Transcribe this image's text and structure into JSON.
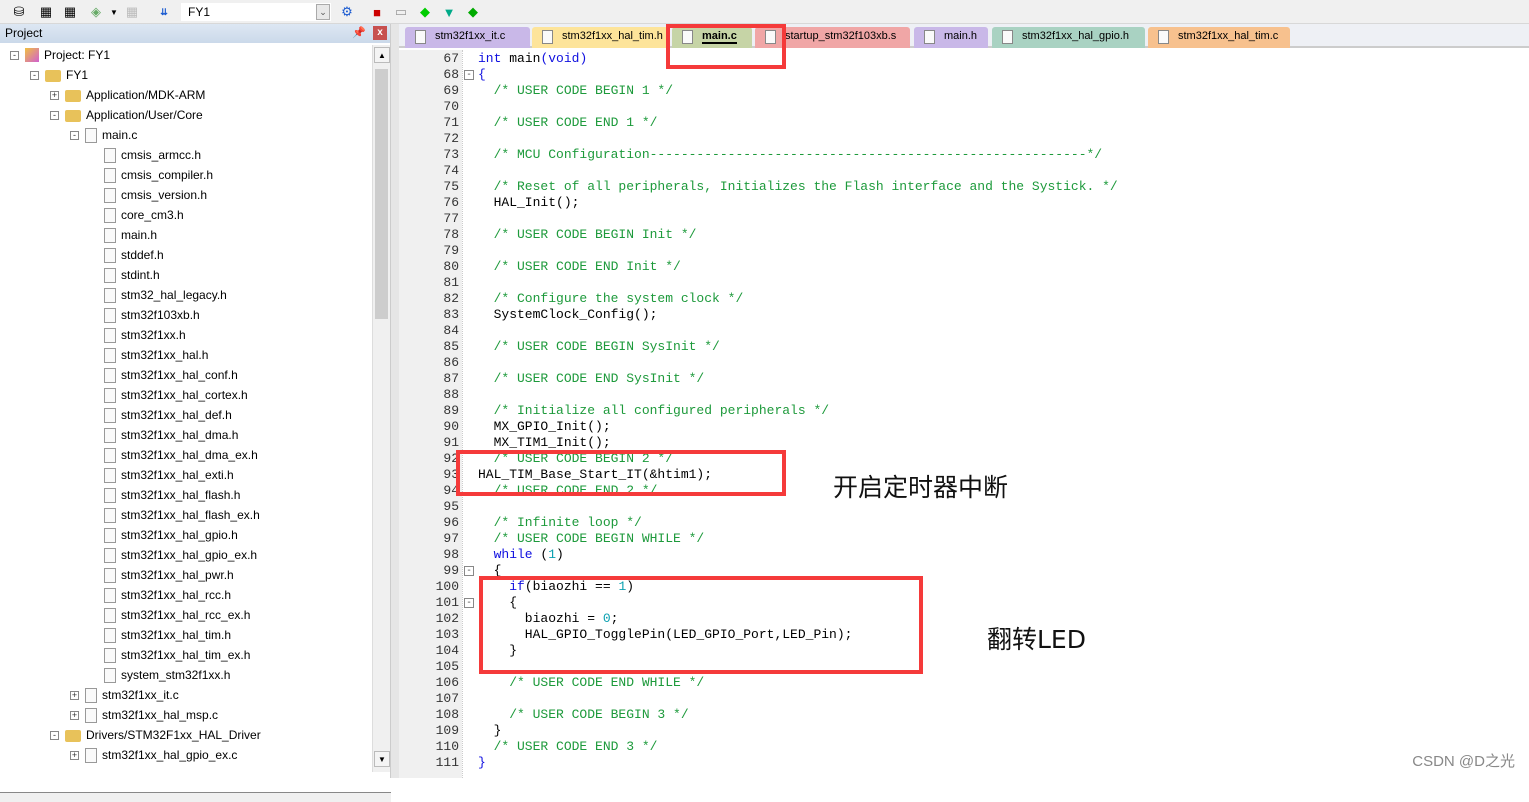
{
  "toolbar": {
    "target": "FY1",
    "icons": [
      "batch-build-icon",
      "build-icon",
      "rebuild-icon",
      "batch-icon",
      "stop-build-icon",
      "download-load-icon",
      "options-wand-icon",
      "manage-components-icon",
      "windows-icon",
      "green-diamond-icon",
      "pack-installer-icon",
      "select-packs-icon"
    ]
  },
  "project_panel": {
    "title": "Project",
    "tree": [
      {
        "label": "Project: FY1",
        "level": 0,
        "exp": "-",
        "icon": "project"
      },
      {
        "label": "FY1",
        "level": 1,
        "exp": "-",
        "icon": "folder"
      },
      {
        "label": "Application/MDK-ARM",
        "level": 2,
        "exp": "+",
        "icon": "folder"
      },
      {
        "label": "Application/User/Core",
        "level": 2,
        "exp": "-",
        "icon": "folder"
      },
      {
        "label": "main.c",
        "level": 3,
        "exp": "-",
        "icon": "file"
      },
      {
        "label": "cmsis_armcc.h",
        "level": 4,
        "icon": "file"
      },
      {
        "label": "cmsis_compiler.h",
        "level": 4,
        "icon": "file"
      },
      {
        "label": "cmsis_version.h",
        "level": 4,
        "icon": "file"
      },
      {
        "label": "core_cm3.h",
        "level": 4,
        "icon": "file"
      },
      {
        "label": "main.h",
        "level": 4,
        "icon": "file"
      },
      {
        "label": "stddef.h",
        "level": 4,
        "icon": "file"
      },
      {
        "label": "stdint.h",
        "level": 4,
        "icon": "file"
      },
      {
        "label": "stm32_hal_legacy.h",
        "level": 4,
        "icon": "file"
      },
      {
        "label": "stm32f103xb.h",
        "level": 4,
        "icon": "file"
      },
      {
        "label": "stm32f1xx.h",
        "level": 4,
        "icon": "file"
      },
      {
        "label": "stm32f1xx_hal.h",
        "level": 4,
        "icon": "file"
      },
      {
        "label": "stm32f1xx_hal_conf.h",
        "level": 4,
        "icon": "file"
      },
      {
        "label": "stm32f1xx_hal_cortex.h",
        "level": 4,
        "icon": "file"
      },
      {
        "label": "stm32f1xx_hal_def.h",
        "level": 4,
        "icon": "file"
      },
      {
        "label": "stm32f1xx_hal_dma.h",
        "level": 4,
        "icon": "file"
      },
      {
        "label": "stm32f1xx_hal_dma_ex.h",
        "level": 4,
        "icon": "file"
      },
      {
        "label": "stm32f1xx_hal_exti.h",
        "level": 4,
        "icon": "file"
      },
      {
        "label": "stm32f1xx_hal_flash.h",
        "level": 4,
        "icon": "file"
      },
      {
        "label": "stm32f1xx_hal_flash_ex.h",
        "level": 4,
        "icon": "file"
      },
      {
        "label": "stm32f1xx_hal_gpio.h",
        "level": 4,
        "icon": "file"
      },
      {
        "label": "stm32f1xx_hal_gpio_ex.h",
        "level": 4,
        "icon": "file"
      },
      {
        "label": "stm32f1xx_hal_pwr.h",
        "level": 4,
        "icon": "file"
      },
      {
        "label": "stm32f1xx_hal_rcc.h",
        "level": 4,
        "icon": "file"
      },
      {
        "label": "stm32f1xx_hal_rcc_ex.h",
        "level": 4,
        "icon": "file"
      },
      {
        "label": "stm32f1xx_hal_tim.h",
        "level": 4,
        "icon": "file"
      },
      {
        "label": "stm32f1xx_hal_tim_ex.h",
        "level": 4,
        "icon": "file"
      },
      {
        "label": "system_stm32f1xx.h",
        "level": 4,
        "icon": "file"
      },
      {
        "label": "stm32f1xx_it.c",
        "level": 3,
        "exp": "+",
        "icon": "file"
      },
      {
        "label": "stm32f1xx_hal_msp.c",
        "level": 3,
        "exp": "+",
        "icon": "file"
      },
      {
        "label": "Drivers/STM32F1xx_HAL_Driver",
        "level": 2,
        "exp": "-",
        "icon": "folder"
      },
      {
        "label": "stm32f1xx_hal_gpio_ex.c",
        "level": 3,
        "exp": "+",
        "icon": "file"
      }
    ]
  },
  "tabs": [
    {
      "label": "stm32f1xx_it.c",
      "color": "#c9b8e8"
    },
    {
      "label": "stm32f1xx_hal_tim.h",
      "color": "#fde49a"
    },
    {
      "label": "main.c",
      "color": "#c6d4a6",
      "active": true
    },
    {
      "label": "startup_stm32f103xb.s",
      "color": "#f0a6a6"
    },
    {
      "label": "main.h",
      "color": "#c9b8e8"
    },
    {
      "label": "stm32f1xx_hal_gpio.h",
      "color": "#a9d2c2"
    },
    {
      "label": "stm32f1xx_hal_tim.c",
      "color": "#f7c18e"
    }
  ],
  "code": [
    {
      "n": 67,
      "s": [
        [
          "int ",
          "kw"
        ],
        [
          "main",
          "pl"
        ],
        [
          "(",
          "pn"
        ],
        [
          "void",
          "kw"
        ],
        [
          ")",
          "pn"
        ]
      ]
    },
    {
      "n": 68,
      "f": "-",
      "s": [
        [
          "{",
          "pn"
        ]
      ]
    },
    {
      "n": 69,
      "s": [
        [
          "  /* USER CODE BEGIN 1 */",
          "cm"
        ]
      ]
    },
    {
      "n": 70,
      "s": []
    },
    {
      "n": 71,
      "s": [
        [
          "  /* USER CODE END 1 */",
          "cm"
        ]
      ]
    },
    {
      "n": 72,
      "s": []
    },
    {
      "n": 73,
      "s": [
        [
          "  /* MCU Configuration--------------------------------------------------------*/",
          "cm"
        ]
      ]
    },
    {
      "n": 74,
      "s": []
    },
    {
      "n": 75,
      "s": [
        [
          "  /* Reset of all peripherals, Initializes the Flash interface and the Systick. */",
          "cm"
        ]
      ]
    },
    {
      "n": 76,
      "s": [
        [
          "  HAL_Init();",
          "pl"
        ]
      ]
    },
    {
      "n": 77,
      "s": []
    },
    {
      "n": 78,
      "s": [
        [
          "  /* USER CODE BEGIN Init */",
          "cm"
        ]
      ]
    },
    {
      "n": 79,
      "s": []
    },
    {
      "n": 80,
      "s": [
        [
          "  /* USER CODE END Init */",
          "cm"
        ]
      ]
    },
    {
      "n": 81,
      "s": []
    },
    {
      "n": 82,
      "s": [
        [
          "  /* Configure the system clock */",
          "cm"
        ]
      ]
    },
    {
      "n": 83,
      "s": [
        [
          "  SystemClock_Config();",
          "pl"
        ]
      ]
    },
    {
      "n": 84,
      "s": []
    },
    {
      "n": 85,
      "s": [
        [
          "  /* USER CODE BEGIN SysInit */",
          "cm"
        ]
      ]
    },
    {
      "n": 86,
      "s": []
    },
    {
      "n": 87,
      "s": [
        [
          "  /* USER CODE END SysInit */",
          "cm"
        ]
      ]
    },
    {
      "n": 88,
      "s": []
    },
    {
      "n": 89,
      "s": [
        [
          "  /* Initialize all configured peripherals */",
          "cm"
        ]
      ]
    },
    {
      "n": 90,
      "s": [
        [
          "  MX_GPIO_Init();",
          "pl"
        ]
      ]
    },
    {
      "n": 91,
      "s": [
        [
          "  MX_TIM1_Init();",
          "pl"
        ]
      ]
    },
    {
      "n": 92,
      "s": [
        [
          "  /* USER CODE BEGIN 2 */",
          "cm"
        ]
      ]
    },
    {
      "n": 93,
      "s": [
        [
          "HAL_TIM_Base_Start_IT(&htim1);",
          "pl"
        ]
      ]
    },
    {
      "n": 94,
      "s": [
        [
          "  /* USER CODE END 2 */",
          "cm"
        ]
      ]
    },
    {
      "n": 95,
      "s": []
    },
    {
      "n": 96,
      "s": [
        [
          "  /* Infinite loop */",
          "cm"
        ]
      ]
    },
    {
      "n": 97,
      "s": [
        [
          "  /* USER CODE BEGIN WHILE */",
          "cm"
        ]
      ]
    },
    {
      "n": 98,
      "s": [
        [
          "  while ",
          "kw"
        ],
        [
          "(",
          "pl"
        ],
        [
          "1",
          "num"
        ],
        [
          ")",
          "pl"
        ]
      ]
    },
    {
      "n": 99,
      "f": "-",
      "s": [
        [
          "  {",
          "pl"
        ]
      ]
    },
    {
      "n": 100,
      "s": [
        [
          "    if",
          "kw"
        ],
        [
          "(biaozhi == ",
          "pl"
        ],
        [
          "1",
          "num"
        ],
        [
          ")",
          "pl"
        ]
      ]
    },
    {
      "n": 101,
      "f": "-",
      "s": [
        [
          "    {",
          "pl"
        ]
      ]
    },
    {
      "n": 102,
      "s": [
        [
          "      biaozhi = ",
          "pl"
        ],
        [
          "0",
          "num"
        ],
        [
          ";",
          "pl"
        ]
      ]
    },
    {
      "n": 103,
      "s": [
        [
          "      HAL_GPIO_TogglePin(LED_GPIO_Port,LED_Pin);",
          "pl"
        ]
      ]
    },
    {
      "n": 104,
      "s": [
        [
          "    }",
          "pl"
        ]
      ]
    },
    {
      "n": 105,
      "s": []
    },
    {
      "n": 106,
      "s": [
        [
          "    /* USER CODE END WHILE */",
          "cm"
        ]
      ]
    },
    {
      "n": 107,
      "s": []
    },
    {
      "n": 108,
      "s": [
        [
          "    /* USER CODE BEGIN 3 */",
          "cm"
        ]
      ]
    },
    {
      "n": 109,
      "s": [
        [
          "  }",
          "pl"
        ]
      ]
    },
    {
      "n": 110,
      "s": [
        [
          "  /* USER CODE END 3 */",
          "cm"
        ]
      ]
    },
    {
      "n": 111,
      "s": [
        [
          "}",
          "pn"
        ]
      ]
    }
  ],
  "annotations": {
    "note1": "开启定时器中断",
    "note2": "翻转LED",
    "highlight_color": "#f53a3a"
  },
  "watermark": "CSDN @D之光"
}
